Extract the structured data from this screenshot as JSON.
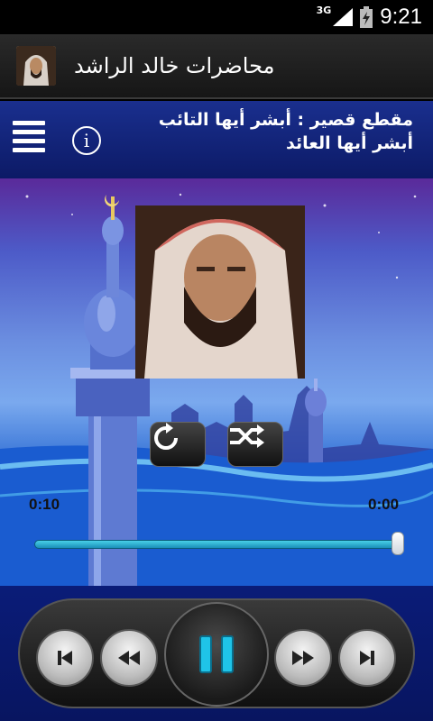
{
  "status": {
    "network": "3G",
    "time": "9:21"
  },
  "app": {
    "title": "محاضرات خالد الراشد",
    "icon": "sheikh-avatar-icon"
  },
  "header": {
    "track_title_line1": "مقطع قصير : أبشر أيها التائب",
    "track_title_line2": "أبشر أيها العائد",
    "menu_icon": "menu-icon",
    "info_icon": "info-icon",
    "info_glyph": "i"
  },
  "player": {
    "elapsed": "0:10",
    "remaining": "0:00",
    "progress": 1.0,
    "repeat_icon": "repeat-icon",
    "shuffle_icon": "shuffle-icon"
  },
  "controls": [
    "skip-previous-icon",
    "rewind-icon",
    "pause-icon",
    "fast-forward-icon",
    "skip-next-icon"
  ],
  "colors": {
    "header": "#1a2f8e",
    "accent": "#1fb8d8",
    "bottom": "#0a1c78"
  }
}
